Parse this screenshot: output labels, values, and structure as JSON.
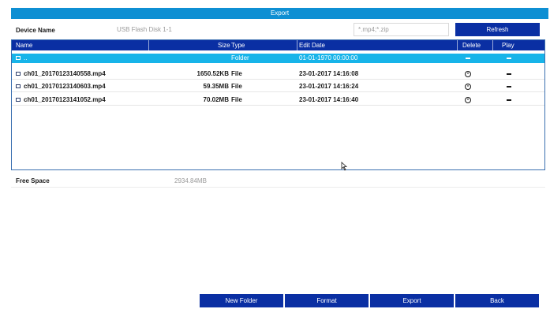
{
  "window": {
    "title": "Export"
  },
  "device": {
    "label": "Device Name",
    "value": "USB Flash Disk 1-1",
    "filter": "*.mp4;*.zip",
    "refresh_label": "Refresh"
  },
  "table": {
    "headers": {
      "name": "Name",
      "size": "Size",
      "type": "Type",
      "edit_date": "Edit Date",
      "delete": "Delete",
      "play": "Play"
    },
    "rows": [
      {
        "name": "..",
        "size": "",
        "type": "Folder",
        "edit_date": "01-01-1970 00:00:00",
        "delete": "dash",
        "play": "dash",
        "selected": true
      },
      {
        "name": "ch01_20170123140558.mp4",
        "size": "1650.52KB",
        "type": "File",
        "edit_date": "23-01-2017 14:16:08",
        "delete": "delete-circle",
        "play": "dash",
        "selected": false
      },
      {
        "name": "ch01_20170123140603.mp4",
        "size": "59.35MB",
        "type": "File",
        "edit_date": "23-01-2017 14:16:24",
        "delete": "delete-circle",
        "play": "dash",
        "selected": false
      },
      {
        "name": "ch01_20170123141052.mp4",
        "size": "70.02MB",
        "type": "File",
        "edit_date": "23-01-2017 14:16:40",
        "delete": "delete-circle",
        "play": "dash",
        "selected": false
      }
    ]
  },
  "free_space": {
    "label": "Free Space",
    "value": "2934.84MB"
  },
  "buttons": {
    "new_folder": "New Folder",
    "format": "Format",
    "export": "Export",
    "back": "Back"
  },
  "colors": {
    "title_bar": "#0e8fd3",
    "header_and_buttons": "#0a2fa3",
    "selected_row": "#17b4e9"
  },
  "icons": {
    "file": "file-icon",
    "dash": "dash-icon",
    "delete": "delete-circle-icon",
    "cursor": "mouse-cursor-icon"
  }
}
